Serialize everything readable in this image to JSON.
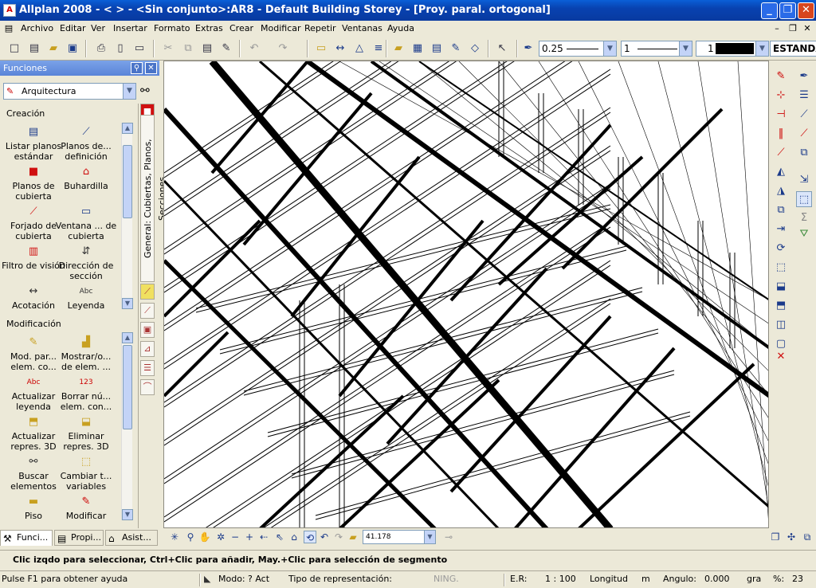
{
  "window": {
    "title": "Allplan 2008 - <     > - <Sin conjunto>:AR8 - Default Building Storey - [Proy. paral. ortogonal]",
    "minimize": "_",
    "restore": "❐",
    "close": "✕"
  },
  "menu": [
    "Archivo",
    "Editar",
    "Ver",
    "Insertar",
    "Formato",
    "Extras",
    "Crear",
    "Modificar",
    "Repetir",
    "Ventanas",
    "Ayuda"
  ],
  "toolbar": {
    "pen": "0.25",
    "line": "1",
    "color": "1",
    "layer": "ESTANDA"
  },
  "panel": {
    "title": "Funciones",
    "module": "Arquitectura",
    "tab_label": "General: Cubiertas, Planos, Secciones",
    "creation_title": "Creación",
    "creation": [
      {
        "label": "Listar planos estándar",
        "icon": "list-planes-icon"
      },
      {
        "label": "Planos de... definición",
        "icon": "plane-definition-icon"
      },
      {
        "label": "Planos de cubierta",
        "icon": "roof-planes-icon"
      },
      {
        "label": "Buhardilla",
        "icon": "dormer-icon"
      },
      {
        "label": "Forjado de cubierta",
        "icon": "roof-slab-icon"
      },
      {
        "label": "Ventana ... de cubierta",
        "icon": "roof-window-icon"
      },
      {
        "label": "Filtro de visión",
        "icon": "view-filter-icon"
      },
      {
        "label": "Dirección de sección",
        "icon": "section-direction-icon"
      },
      {
        "label": "Acotación",
        "icon": "dimension-icon"
      },
      {
        "label": "Leyenda",
        "icon": "legend-icon"
      }
    ],
    "modification_title": "Modificación",
    "modification": [
      {
        "label": "Mod. par... elem. co...",
        "icon": "modify-params-icon"
      },
      {
        "label": "Mostrar/o... de elem. ...",
        "icon": "show-hide-icon"
      },
      {
        "label": "Actualizar leyenda",
        "icon": "update-legend-icon"
      },
      {
        "label": "Borrar nú... elem. con...",
        "icon": "delete-number-icon"
      },
      {
        "label": "Actualizar repres. 3D",
        "icon": "update-3d-icon"
      },
      {
        "label": "Eliminar repres. 3D",
        "icon": "delete-3d-icon"
      },
      {
        "label": "Buscar elementos",
        "icon": "binoculars-icon"
      },
      {
        "label": "Cambiar t... variables",
        "icon": "change-variables-icon"
      },
      {
        "label": "Piso",
        "icon": "floor-icon"
      },
      {
        "label": "Modificar",
        "icon": "modify-icon"
      }
    ],
    "bottom_tabs": [
      "Funci...",
      "Propi...",
      "Asist..."
    ]
  },
  "view_toolbar": {
    "zoom": "41.178"
  },
  "prompt": "Clic izqdo para seleccionar, Ctrl+Clic para añadir, May.+Clic para selección de segmento",
  "status": {
    "help": "Pulse F1 para obtener ayuda",
    "mode_label": "Modo:",
    "mode_value": "? Act",
    "repr_label": "Tipo de representación:",
    "repr_value": "NING.",
    "er_label": "E.R:",
    "er_value": "1 : 100",
    "length_label": "Longitud",
    "length_unit": "m",
    "angle_label": "Angulo:",
    "angle_value": "0.000",
    "angle_unit": "gra",
    "pct_label": "%:",
    "pct_value": "23"
  }
}
